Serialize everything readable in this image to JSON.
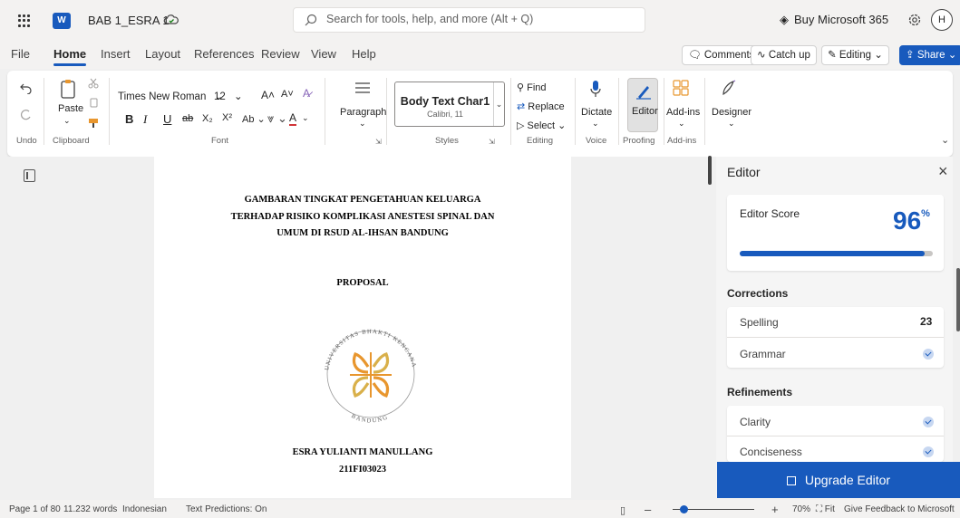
{
  "titlebar": {
    "doc_title": "BAB 1_ESRA 1",
    "search_placeholder": "Search for tools, help, and more (Alt + Q)",
    "buy_label": "Buy Microsoft 365",
    "avatar_initial": "H"
  },
  "tabs": [
    "File",
    "Home",
    "Insert",
    "Layout",
    "References",
    "Review",
    "View",
    "Help"
  ],
  "active_tab": "Home",
  "actions": {
    "comments": "Comments",
    "catchup": "Catch up",
    "editing": "Editing",
    "share": "Share"
  },
  "ribbon": {
    "undo_label": "Undo",
    "paste_label": "Paste",
    "clipboard_label": "Clipboard",
    "font_name": "Times New Roman",
    "font_size": "12",
    "font_label": "Font",
    "bold": "B",
    "italic": "I",
    "underline": "U",
    "paragraph_label": "Paragraph",
    "style_name": "Body Text Char1",
    "style_sub": "Calibri, 11",
    "styles_label": "Styles",
    "find": "Find",
    "replace": "Replace",
    "select": "Select",
    "editing_label": "Editing",
    "dictate": "Dictate",
    "voice_label": "Voice",
    "editor": "Editor",
    "proofing_label": "Proofing",
    "addins": "Add-ins",
    "addins_label": "Add-ins",
    "designer": "Designer"
  },
  "document": {
    "title_lines": [
      "GAMBARAN TINGKAT PENGETAHUAN KELUARGA",
      "TERHADAP RISIKO KOMPLIKASI ANESTESI SPINAL DAN",
      "UMUM DI RSUD AL-IHSAN BANDUNG"
    ],
    "subtitle": "PROPOSAL",
    "logo_text_top": "UNIVERSITAS BHAKTI KENCANA",
    "logo_text_bottom": "BANDUNG",
    "author": "ESRA YULIANTI MANULLANG",
    "student_id": "211FI03023"
  },
  "editor_pane": {
    "title": "Editor",
    "score_label": "Editor Score",
    "score_value": "96",
    "score_unit": "%",
    "score_fraction": 0.96,
    "corrections_head": "Corrections",
    "spelling": "Spelling",
    "spelling_count": "23",
    "grammar": "Grammar",
    "refinements_head": "Refinements",
    "clarity": "Clarity",
    "conciseness": "Conciseness",
    "upgrade": "Upgrade Editor"
  },
  "status": {
    "page": "Page 1 of 80",
    "words": "11.232 words",
    "language": "Indonesian",
    "predictions": "Text Predictions: On",
    "zoom": "70%",
    "fit": "Fit",
    "feedback": "Give Feedback to Microsoft"
  },
  "colors": {
    "accent": "#185abd",
    "ribbon_bg": "#ffffff",
    "chrome_bg": "#f3f2f1",
    "logo_orange": "#e8962e",
    "logo_gold": "#d9b04a"
  }
}
